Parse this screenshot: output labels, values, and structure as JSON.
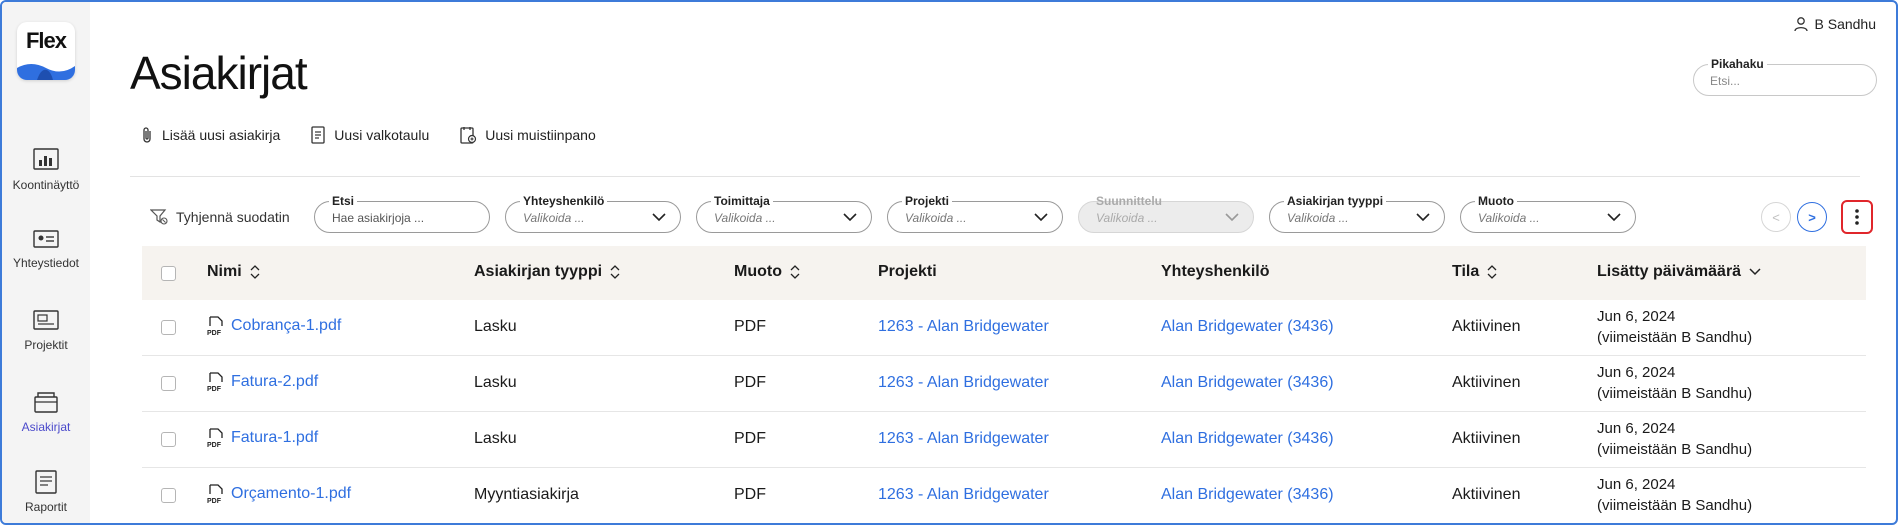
{
  "app": {
    "logo_text": "Flex",
    "brand_color": "#2f6fe0",
    "accent_color": "#4b4acb",
    "alert_color": "#e0262b"
  },
  "user": {
    "name": "B Sandhu",
    "icon": "user-icon"
  },
  "sidebar": {
    "items": [
      {
        "label": "Koontinäyttö",
        "icon": "dashboard-icon"
      },
      {
        "label": "Yhteystiedot",
        "icon": "contact-card-icon"
      },
      {
        "label": "Projektit",
        "icon": "projects-icon"
      },
      {
        "label": "Asiakirjat",
        "icon": "documents-icon",
        "active": true
      },
      {
        "label": "Raportit",
        "icon": "reports-icon"
      }
    ]
  },
  "page": {
    "title": "Asiakirjat"
  },
  "quick_search": {
    "label": "Pikahaku",
    "placeholder": "Etsi..."
  },
  "actions": [
    {
      "label": "Lisää uusi asiakirja",
      "icon": "paperclip-icon"
    },
    {
      "label": "Uusi valkotaulu",
      "icon": "whiteboard-icon"
    },
    {
      "label": "Uusi muistiinpano",
      "icon": "note-icon"
    }
  ],
  "filters": {
    "clear_label": "Tyhjennä suodatin",
    "search": {
      "label": "Etsi",
      "placeholder": "Hae asiakirjoja ..."
    },
    "contact": {
      "label": "Yhteyshenkilö",
      "placeholder": "Valikoida ..."
    },
    "supplier": {
      "label": "Toimittaja",
      "placeholder": "Valikoida ..."
    },
    "project": {
      "label": "Projekti",
      "placeholder": "Valikoida ..."
    },
    "planning": {
      "label": "Suunnittelu",
      "placeholder": "Valikoida ...",
      "disabled": true
    },
    "doc_type": {
      "label": "Asiakirjan tyyppi",
      "placeholder": "Valikoida ..."
    },
    "format": {
      "label": "Muoto",
      "placeholder": "Valikoida ..."
    }
  },
  "pager": {
    "prev": "<",
    "next": ">"
  },
  "table": {
    "headers": {
      "name": "Nimi",
      "doc_type": "Asiakirjan tyyppi",
      "format": "Muoto",
      "project": "Projekti",
      "contact": "Yhteyshenkilö",
      "status": "Tila",
      "added": "Lisätty päivämäärä"
    },
    "rows": [
      {
        "name": "Cobrança-1.pdf",
        "doc_type": "Lasku",
        "format": "PDF",
        "project": "1263 - Alan Bridgewater",
        "contact": "Alan Bridgewater (3436)",
        "status": "Aktiivinen",
        "date": "Jun 6, 2024",
        "updated_by": "(viimeistään B Sandhu)"
      },
      {
        "name": "Fatura-2.pdf",
        "doc_type": "Lasku",
        "format": "PDF",
        "project": "1263 - Alan Bridgewater",
        "contact": "Alan Bridgewater (3436)",
        "status": "Aktiivinen",
        "date": "Jun 6, 2024",
        "updated_by": "(viimeistään B Sandhu)"
      },
      {
        "name": "Fatura-1.pdf",
        "doc_type": "Lasku",
        "format": "PDF",
        "project": "1263 - Alan Bridgewater",
        "contact": "Alan Bridgewater (3436)",
        "status": "Aktiivinen",
        "date": "Jun 6, 2024",
        "updated_by": "(viimeistään B Sandhu)"
      },
      {
        "name": "Orçamento-1.pdf",
        "doc_type": "Myyntiasiakirja",
        "format": "PDF",
        "project": "1263 - Alan Bridgewater",
        "contact": "Alan Bridgewater (3436)",
        "status": "Aktiivinen",
        "date": "Jun 6, 2024",
        "updated_by": "(viimeistään B Sandhu)"
      }
    ]
  }
}
